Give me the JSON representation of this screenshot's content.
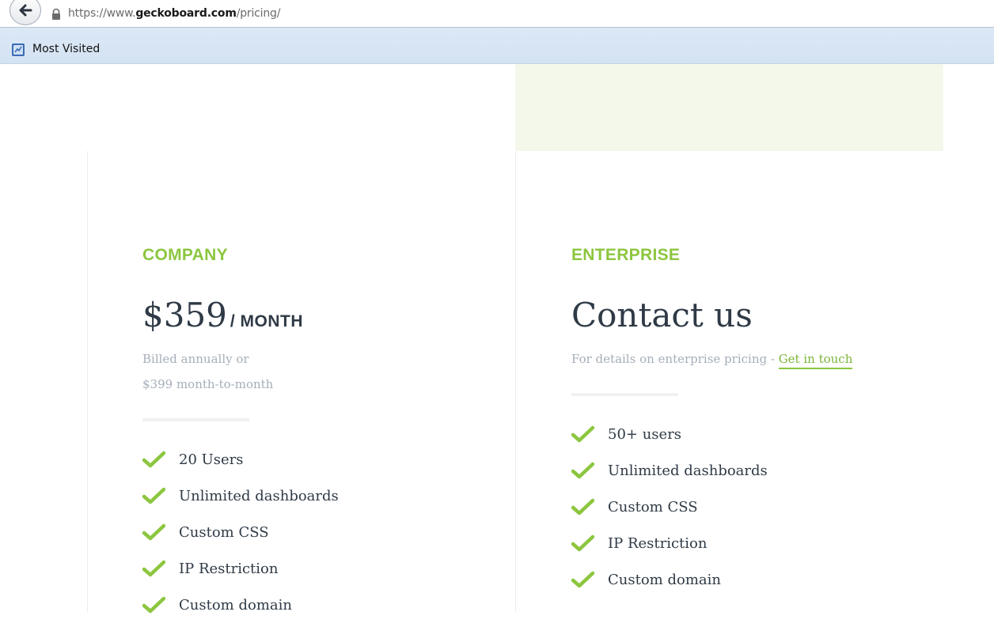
{
  "browser": {
    "url_prefix": "https://www.",
    "url_domain": "geckoboard.com",
    "url_path": "/pricing/",
    "bookmarks_label": "Most Visited"
  },
  "plans": [
    {
      "name": "COMPANY",
      "price": "$359",
      "per": "/ MONTH",
      "billing_line1": "Billed annually or",
      "billing_line2": "$399 month-to-month",
      "features": [
        "20 Users",
        "Unlimited dashboards",
        "Custom CSS",
        "IP Restriction",
        "Custom domain"
      ]
    },
    {
      "name": "ENTERPRISE",
      "price": "Contact us",
      "details_text": "For details on enterprise pricing - ",
      "details_link": "Get in touch",
      "features": [
        "50+ users",
        "Unlimited dashboards",
        "Custom CSS",
        "IP Restriction",
        "Custom domain"
      ]
    }
  ],
  "colors": {
    "accent_green": "#8cc63f",
    "text_dark": "#2f3a46",
    "text_muted": "#a6aeba",
    "panel_green": "#f4f8eb"
  }
}
